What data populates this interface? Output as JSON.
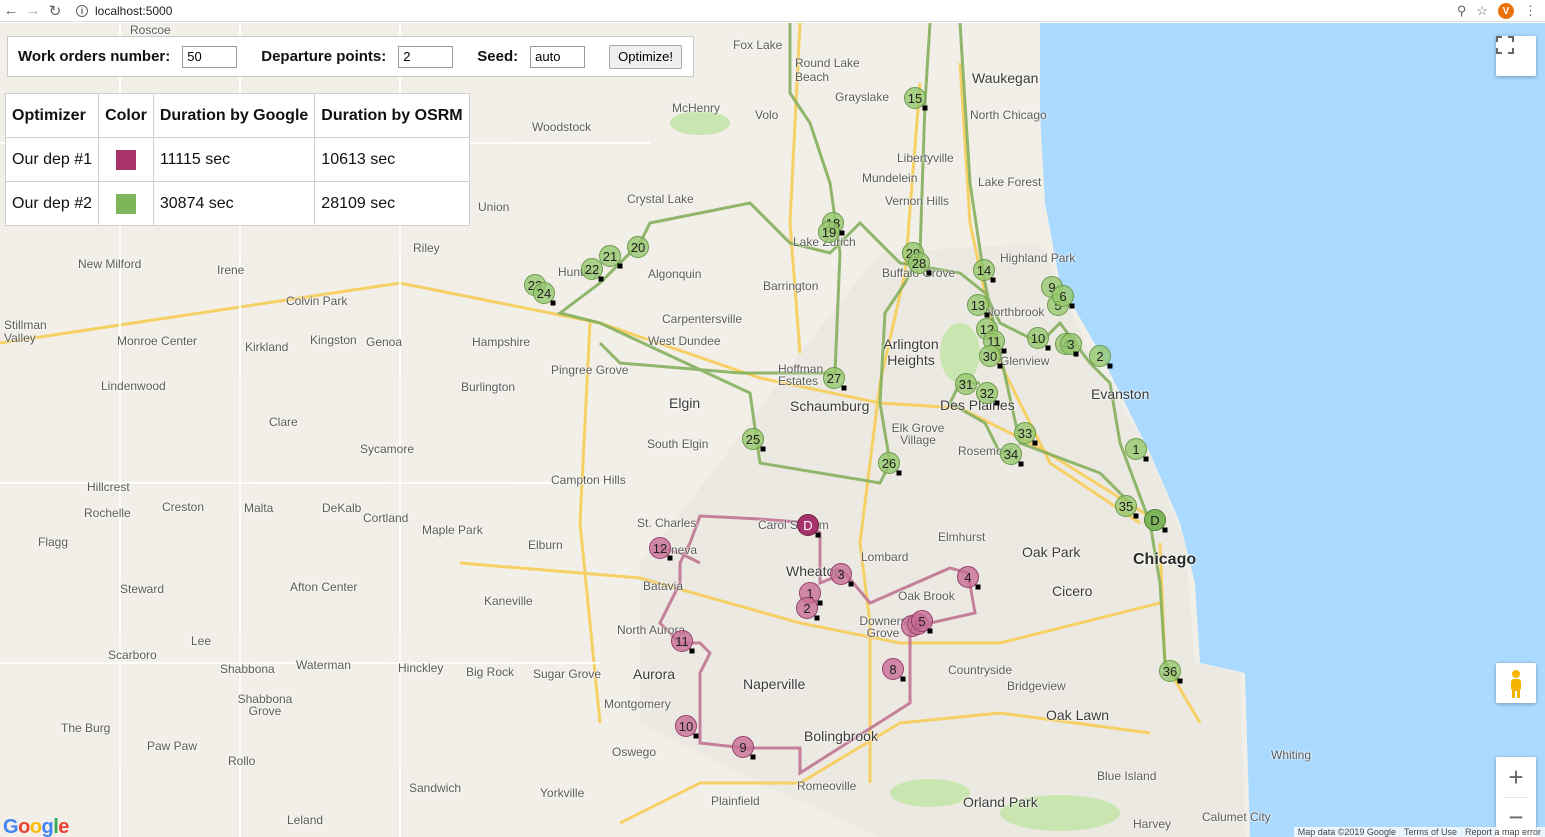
{
  "browser": {
    "url": "localhost:5000",
    "avatar_letter": "V"
  },
  "controls": {
    "work_orders_label": "Work orders number:",
    "work_orders_value": "50",
    "departure_label": "Departure points:",
    "departure_value": "2",
    "seed_label": "Seed:",
    "seed_value": "auto",
    "optimize_label": "Optimize!"
  },
  "results": {
    "headers": [
      "Optimizer",
      "Color",
      "Duration by Google",
      "Duration by OSRM"
    ],
    "rows": [
      {
        "optimizer": "Our dep #1",
        "color": "#a8326a",
        "google": "11115 sec",
        "osrm": "10613 sec"
      },
      {
        "optimizer": "Our dep #2",
        "color": "#7cb55a",
        "google": "30874 sec",
        "osrm": "28109 sec"
      }
    ]
  },
  "map": {
    "places": [
      {
        "name": "Roscoe"
      },
      {
        "name": "Fox Lake"
      },
      {
        "name": "Round Lake Beach"
      },
      {
        "name": "Waukegan"
      },
      {
        "name": "Grayslake"
      },
      {
        "name": "McHenry"
      },
      {
        "name": "Volo"
      },
      {
        "name": "North Chicago"
      },
      {
        "name": "Woodstock"
      },
      {
        "name": "Libertyville"
      },
      {
        "name": "Mundelein"
      },
      {
        "name": "Lake Forest"
      },
      {
        "name": "Crystal Lake"
      },
      {
        "name": "Vernon Hills"
      },
      {
        "name": "Union"
      },
      {
        "name": "Riley"
      },
      {
        "name": "Lake Zurich"
      },
      {
        "name": "Highland Park"
      },
      {
        "name": "New Milford"
      },
      {
        "name": "Irene"
      },
      {
        "name": "Huntley"
      },
      {
        "name": "Algonquin"
      },
      {
        "name": "Buffalo Grove"
      },
      {
        "name": "Barrington"
      },
      {
        "name": "Colvin Park"
      },
      {
        "name": "Stillman Valley"
      },
      {
        "name": "Monroe Center"
      },
      {
        "name": "Kirkland"
      },
      {
        "name": "Kingston"
      },
      {
        "name": "Genoa"
      },
      {
        "name": "Hampshire"
      },
      {
        "name": "Carpentersville"
      },
      {
        "name": "West Dundee"
      },
      {
        "name": "Northbrook"
      },
      {
        "name": "Arlington Heights"
      },
      {
        "name": "Glenview"
      },
      {
        "name": "Lindenwood"
      },
      {
        "name": "Burlington"
      },
      {
        "name": "Pingree Grove"
      },
      {
        "name": "Hoffman Estates"
      },
      {
        "name": "Schaumburg"
      },
      {
        "name": "Des Plaines"
      },
      {
        "name": "Evanston"
      },
      {
        "name": "Elgin"
      },
      {
        "name": "Clare"
      },
      {
        "name": "South Elgin"
      },
      {
        "name": "Elk Grove Village"
      },
      {
        "name": "Rosemont"
      },
      {
        "name": "Sycamore"
      },
      {
        "name": "Hillcrest"
      },
      {
        "name": "Campton Hills"
      },
      {
        "name": "Rochelle"
      },
      {
        "name": "Creston"
      },
      {
        "name": "Malta"
      },
      {
        "name": "DeKalb"
      },
      {
        "name": "Cortland"
      },
      {
        "name": "Maple Park"
      },
      {
        "name": "St. Charles"
      },
      {
        "name": "Carol Stream"
      },
      {
        "name": "Elmhurst"
      },
      {
        "name": "Oak Park"
      },
      {
        "name": "Chicago"
      },
      {
        "name": "Flagg"
      },
      {
        "name": "Elburn"
      },
      {
        "name": "Geneva"
      },
      {
        "name": "Lombard"
      },
      {
        "name": "Wheaton"
      },
      {
        "name": "Batavia"
      },
      {
        "name": "Steward"
      },
      {
        "name": "Afton Center"
      },
      {
        "name": "Kaneville"
      },
      {
        "name": "Cicero"
      },
      {
        "name": "Oak Brook"
      },
      {
        "name": "Downers Grove"
      },
      {
        "name": "North Aurora"
      },
      {
        "name": "Lee"
      },
      {
        "name": "Scarboro"
      },
      {
        "name": "Shabbona"
      },
      {
        "name": "Waterman"
      },
      {
        "name": "Hinckley"
      },
      {
        "name": "Big Rock"
      },
      {
        "name": "Sugar Grove"
      },
      {
        "name": "Aurora"
      },
      {
        "name": "Naperville"
      },
      {
        "name": "Countryside"
      },
      {
        "name": "Bridgeview"
      },
      {
        "name": "Shabbona Grove"
      },
      {
        "name": "Montgomery"
      },
      {
        "name": "Oak Lawn"
      },
      {
        "name": "The Burg"
      },
      {
        "name": "Bolingbrook"
      },
      {
        "name": "Paw Paw"
      },
      {
        "name": "Oswego"
      },
      {
        "name": "Rollo"
      },
      {
        "name": "Sandwich"
      },
      {
        "name": "Yorkville"
      },
      {
        "name": "Romeoville"
      },
      {
        "name": "Blue Island"
      },
      {
        "name": "Whiting"
      },
      {
        "name": "Plainfield"
      },
      {
        "name": "Orland Park"
      },
      {
        "name": "Leland"
      },
      {
        "name": "Harvey"
      },
      {
        "name": "Calumet City"
      }
    ],
    "markers_green": [
      "15",
      "18",
      "19",
      "20",
      "21",
      "22",
      "23",
      "24",
      "29",
      "28",
      "14",
      "9",
      "5",
      "6",
      "13",
      "12",
      "11",
      "10",
      "4",
      "3",
      "30",
      "2",
      "31",
      "32",
      "27",
      "25",
      "33",
      "34",
      "1",
      "26",
      "35",
      "D",
      "36"
    ],
    "markers_red": [
      "D",
      "12",
      "3",
      "1",
      "2",
      "4",
      "7",
      "6",
      "5",
      "11",
      "8",
      "10",
      "9"
    ],
    "attribution": [
      "Map data ©2019 Google",
      "Terms of Use",
      "Report a map error"
    ],
    "logo": "Google"
  }
}
